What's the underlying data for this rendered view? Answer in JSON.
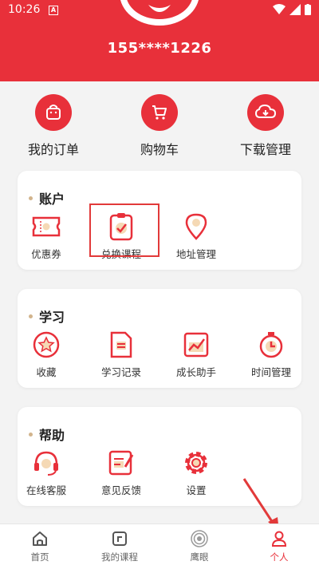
{
  "status": {
    "time": "10:26",
    "app_badge": "A"
  },
  "profile": {
    "phone": "155****1226"
  },
  "quick_actions": [
    {
      "label": "我的订单",
      "icon": "bag-icon"
    },
    {
      "label": "购物车",
      "icon": "cart-icon"
    },
    {
      "label": "下载管理",
      "icon": "cloud-download-icon"
    }
  ],
  "account": {
    "title": "账户",
    "items": [
      {
        "label": "优惠券",
        "icon": "coupon-icon"
      },
      {
        "label": "兑换课程",
        "icon": "redeem-course-icon"
      },
      {
        "label": "地址管理",
        "icon": "location-icon"
      }
    ]
  },
  "study": {
    "title": "学习",
    "items": [
      {
        "label": "收藏",
        "icon": "star-icon"
      },
      {
        "label": "学习记录",
        "icon": "document-icon"
      },
      {
        "label": "成长助手",
        "icon": "growth-chart-icon"
      },
      {
        "label": "时间管理",
        "icon": "timer-icon"
      }
    ]
  },
  "help": {
    "title": "帮助",
    "items": [
      {
        "label": "在线客服",
        "icon": "headset-icon"
      },
      {
        "label": "意见反馈",
        "icon": "feedback-icon"
      },
      {
        "label": "设置",
        "icon": "gear-icon"
      }
    ]
  },
  "tabs": [
    {
      "label": "首页",
      "icon": "home-icon"
    },
    {
      "label": "我的课程",
      "icon": "my-course-icon"
    },
    {
      "label": "鹰眼",
      "icon": "eye-icon"
    },
    {
      "label": "个人",
      "icon": "person-icon",
      "active": true
    }
  ],
  "colors": {
    "brand": "#e8303a",
    "dot": "#d2b48c",
    "highlight": "#e23a3a"
  }
}
